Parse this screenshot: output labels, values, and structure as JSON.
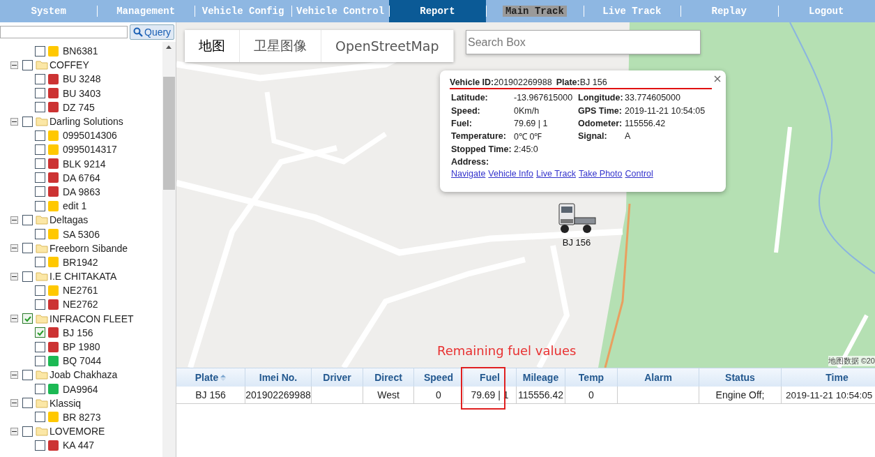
{
  "nav": [
    {
      "label": "System",
      "selected": false,
      "hovered": false
    },
    {
      "label": "Management",
      "selected": false,
      "hovered": false
    },
    {
      "label": "Vehicle Config",
      "selected": false,
      "hovered": false
    },
    {
      "label": "Vehicle Control",
      "selected": false,
      "hovered": false
    },
    {
      "label": "Report",
      "selected": true,
      "hovered": false
    },
    {
      "label": "Main Track",
      "selected": false,
      "hovered": true
    },
    {
      "label": "Live Track",
      "selected": false,
      "hovered": false
    },
    {
      "label": "Replay",
      "selected": false,
      "hovered": false
    },
    {
      "label": "Logout",
      "selected": false,
      "hovered": false
    }
  ],
  "sidebar": {
    "query_button": "Query",
    "tree": [
      {
        "children": [
          {
            "label": "BN6381",
            "color": "#ffc800",
            "checked": false
          }
        ]
      },
      {
        "label": "COFFEY",
        "expanded": true,
        "checked": false,
        "children": [
          {
            "label": "BU 3248",
            "color": "#cc3333",
            "checked": false
          },
          {
            "label": "BU 3403",
            "color": "#cc3333",
            "checked": false
          },
          {
            "label": "DZ 745",
            "color": "#cc3333",
            "checked": false
          }
        ]
      },
      {
        "label": "Darling Solutions",
        "expanded": true,
        "checked": false,
        "children": [
          {
            "label": "0995014306",
            "color": "#ffc800",
            "checked": false
          },
          {
            "label": "0995014317",
            "color": "#ffc800",
            "checked": false
          },
          {
            "label": "BLK 9214",
            "color": "#cc3333",
            "checked": false
          },
          {
            "label": "DA 6764",
            "color": "#cc3333",
            "checked": false
          },
          {
            "label": "DA 9863",
            "color": "#cc3333",
            "checked": false
          },
          {
            "label": "edit 1",
            "color": "#ffc800",
            "checked": false
          }
        ]
      },
      {
        "label": "Deltagas",
        "expanded": true,
        "checked": false,
        "children": [
          {
            "label": "SA 5306",
            "color": "#ffc800",
            "checked": false
          }
        ]
      },
      {
        "label": "Freeborn Sibande",
        "expanded": true,
        "checked": false,
        "children": [
          {
            "label": "BR1942",
            "color": "#ffc800",
            "checked": false
          }
        ]
      },
      {
        "label": "I.E CHITAKATA",
        "expanded": true,
        "checked": false,
        "children": [
          {
            "label": "NE2761",
            "color": "#ffc800",
            "checked": false
          },
          {
            "label": "NE2762",
            "color": "#cc3333",
            "checked": false
          }
        ]
      },
      {
        "label": "INFRACON FLEET",
        "expanded": true,
        "checked": true,
        "children": [
          {
            "label": "BJ 156",
            "color": "#cc3333",
            "checked": true
          },
          {
            "label": "BP 1980",
            "color": "#cc3333",
            "checked": false
          },
          {
            "label": "BQ 7044",
            "color": "#1cb954",
            "checked": false
          }
        ]
      },
      {
        "label": "Joab Chakhaza",
        "expanded": true,
        "checked": false,
        "children": [
          {
            "label": "DA9964",
            "color": "#1cb954",
            "checked": false
          }
        ]
      },
      {
        "label": "Klassiq",
        "expanded": true,
        "checked": false,
        "children": [
          {
            "label": "BR 8273",
            "color": "#ffc800",
            "checked": false
          }
        ]
      },
      {
        "label": "LOVEMORE",
        "expanded": true,
        "checked": false,
        "children": [
          {
            "label": "KA 447",
            "color": "#cc3333",
            "checked": false
          }
        ]
      }
    ]
  },
  "map": {
    "map_types": [
      {
        "label": "地图",
        "selected": true
      },
      {
        "label": "卫星图像",
        "selected": false
      },
      {
        "label": "OpenStreetMap",
        "selected": false
      }
    ],
    "search": {
      "placeholder": "Search Box"
    },
    "marker": {
      "label": "BJ 156"
    },
    "attribution": "地图数据 ©20",
    "annotation": "Remaining fuel values",
    "popup": {
      "id_label": "Vehicle ID:",
      "id": "201902269988",
      "plate_label": "Plate:",
      "plate": "BJ 156",
      "rows": [
        [
          {
            "label": "Latitude:",
            "value": "-13.967615000"
          },
          {
            "label": "Longitude:",
            "value": "33.774605000"
          }
        ],
        [
          {
            "label": "Speed:",
            "value": "0Km/h"
          },
          {
            "label": "GPS Time:",
            "value": "2019-11-21 10:54:05"
          }
        ],
        [
          {
            "label": "Fuel:",
            "value": "79.69 | 1"
          },
          {
            "label": "Odometer:",
            "value": "115556.42"
          }
        ],
        [
          {
            "label": "Temperature:",
            "value": "0℃ 0℉"
          },
          {
            "label": "Signal:",
            "value": "A"
          }
        ],
        [
          {
            "label": "Stopped Time:",
            "value": "2:45:0"
          }
        ],
        [
          {
            "label": "Address:"
          }
        ]
      ],
      "links": [
        "Navigate",
        "Vehicle Info",
        "Live Track",
        "Take Photo",
        "Control"
      ]
    }
  },
  "table": {
    "columns": [
      {
        "label": "Plate",
        "sorted": true
      },
      {
        "label": "Imei No.",
        "sorted": false
      },
      {
        "label": "Driver",
        "sorted": false
      },
      {
        "label": "Direct",
        "sorted": false
      },
      {
        "label": "Speed",
        "sorted": false
      },
      {
        "label": "Fuel",
        "sorted": false,
        "highlighted": true
      },
      {
        "label": "Mileage",
        "sorted": false
      },
      {
        "label": "Temp",
        "sorted": false
      },
      {
        "label": "Alarm",
        "sorted": false
      },
      {
        "label": "Status",
        "sorted": false
      },
      {
        "label": "Time",
        "sorted": false
      }
    ],
    "rows": [
      [
        "BJ 156",
        "201902269988",
        "",
        "West",
        "0",
        "79.69 | 1",
        "115556.42",
        "0",
        "",
        "Engine Off;",
        "2019-11-21 10:54:05"
      ]
    ]
  }
}
